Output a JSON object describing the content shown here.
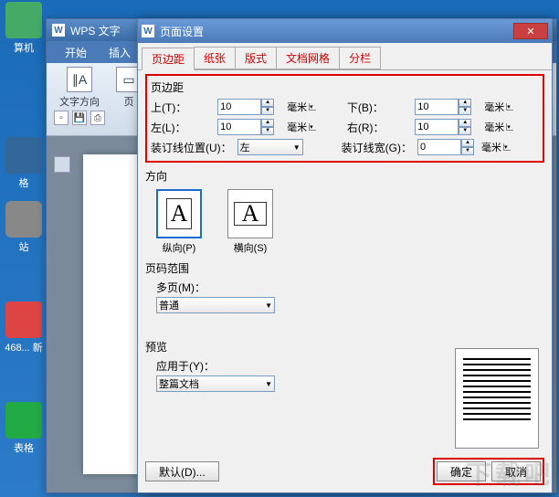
{
  "desktop": {
    "icons": [
      "算机",
      "格",
      "站",
      "468... 新",
      "表格"
    ]
  },
  "wps": {
    "title": "WPS 文字",
    "tabs": {
      "start": "开始",
      "insert": "插入"
    },
    "tools": {
      "text_dir": "文字方向",
      "page": "页"
    }
  },
  "dialog": {
    "title": "页面设置",
    "tabs": {
      "margin": "页边距",
      "paper": "纸张",
      "layout": "版式",
      "grid": "文档网格",
      "columns": "分栏"
    },
    "margins": {
      "group": "页边距",
      "top_label": "上(T)：",
      "top_value": "10",
      "bottom_label": "下(B)：",
      "bottom_value": "10",
      "left_label": "左(L)：",
      "left_value": "10",
      "right_label": "右(R)：",
      "right_value": "10",
      "unit": "毫米",
      "gutter_pos_label": "装订线位置(U)：",
      "gutter_pos_value": "左",
      "gutter_width_label": "装订线宽(G)：",
      "gutter_width_value": "0"
    },
    "orientation": {
      "group": "方向",
      "portrait": "纵向(P)",
      "landscape": "横向(S)"
    },
    "pagerange": {
      "group": "页码范围",
      "multi_label": "多页(M)：",
      "multi_value": "普通"
    },
    "preview": {
      "group": "预览",
      "apply_label": "应用于(Y)：",
      "apply_value": "整篇文档"
    },
    "buttons": {
      "default": "默认(D)...",
      "ok": "确定",
      "cancel": "取消"
    }
  }
}
